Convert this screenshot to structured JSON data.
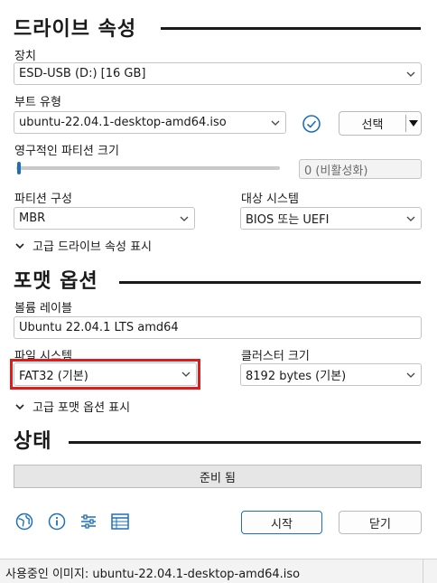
{
  "drive_properties": {
    "title": "드라이브 속성",
    "device_label": "장치",
    "device_value": "ESD-USB (D:) [16 GB]",
    "boot_type_label": "부트 유형",
    "boot_type_value": "ubuntu-22.04.1-desktop-amd64.iso",
    "select_button": "선택",
    "persistent_label": "영구적인 파티션 크기",
    "persistent_value": "0 (비활성화)",
    "persistent_fraction": 0,
    "partition_label": "파티션 구성",
    "partition_value": "MBR",
    "target_label": "대상 시스템",
    "target_value": "BIOS 또는 UEFI",
    "advanced": "고급 드라이브 속성 표시"
  },
  "format_options": {
    "title": "포맷 옵션",
    "volume_label": "볼륨 레이블",
    "volume_value": "Ubuntu 22.04.1 LTS amd64",
    "filesystem_label": "파일 시스템",
    "filesystem_value": "FAT32 (기본)",
    "cluster_label": "클러스터 크기",
    "cluster_value": "8192 bytes (기본)",
    "advanced": "고급 포맷 옵션 표시"
  },
  "status": {
    "title": "상태",
    "progress_text": "준비 됨"
  },
  "actions": {
    "start": "시작",
    "close": "닫기"
  },
  "statusbar": {
    "text": "사용중인 이미지: ubuntu-22.04.1-desktop-amd64.iso"
  },
  "colors": {
    "accent": "#1e6fb8",
    "highlight": "#e01b1b"
  }
}
